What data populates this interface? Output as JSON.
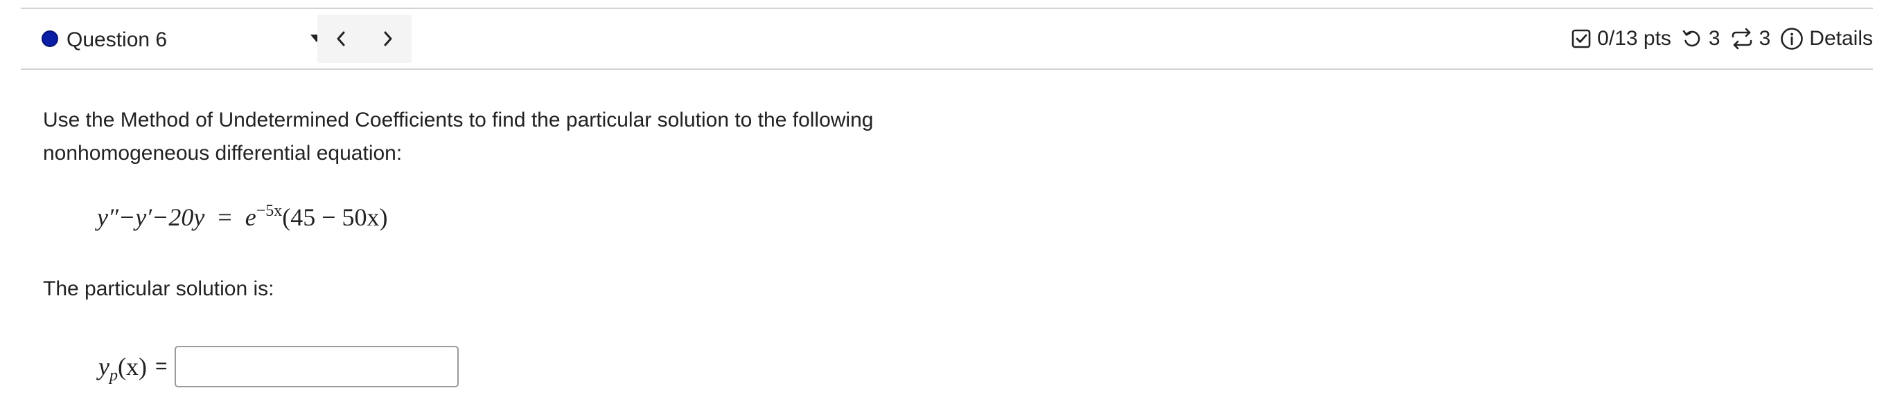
{
  "header": {
    "question_label": "Question 6",
    "prev_icon": "chevron-left-icon",
    "next_icon": "chevron-right-icon",
    "points": "0/13 pts",
    "retries_remaining": "3",
    "attempts_remaining": "3",
    "details_label": "Details",
    "status_color": "#0a1fa6"
  },
  "question": {
    "prompt_line1": "Use the Method of Undetermined Coefficients to find the particular solution to the following",
    "prompt_line2": "nonhomogeneous differential equation:",
    "equation_lhs": "y″−y′−20y",
    "equation_equals": "=",
    "equation_base": "e",
    "equation_exponent": "−5x",
    "equation_rhs": "(45 − 50x)",
    "answer_prompt": "The particular solution is:",
    "answer_label_base": "y",
    "answer_label_sub": "p",
    "answer_label_arg": "(x)",
    "answer_equals": "=",
    "answer_value": ""
  }
}
